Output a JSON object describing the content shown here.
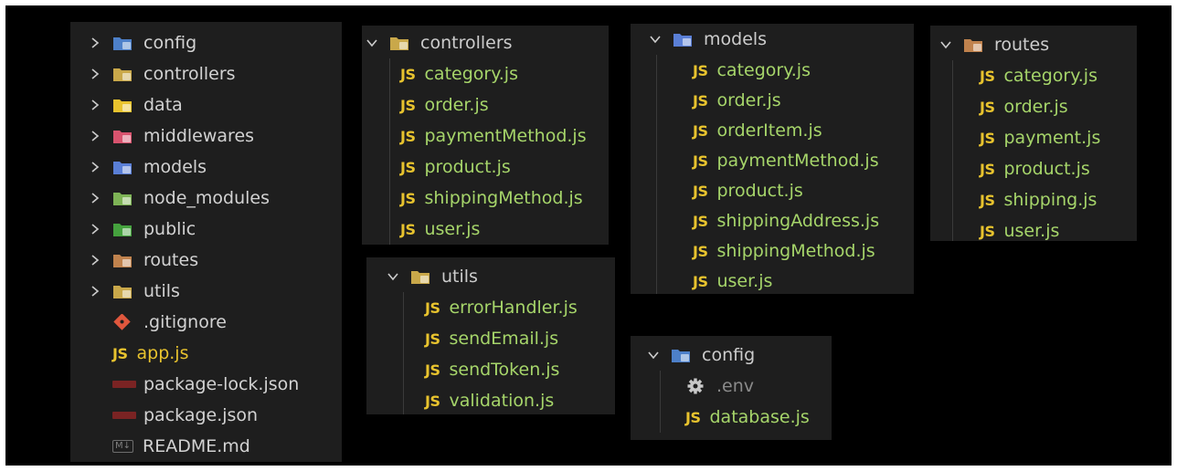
{
  "root_panel": {
    "folders": [
      {
        "name": "config",
        "icon": "config-folder-icon",
        "color": "#4d80c9"
      },
      {
        "name": "controllers",
        "icon": "controllers-folder-icon",
        "color": "#c9a84a"
      },
      {
        "name": "data",
        "icon": "data-folder-icon",
        "color": "#e8c32e"
      },
      {
        "name": "middlewares",
        "icon": "middlewares-folder-icon",
        "color": "#d8546f"
      },
      {
        "name": "models",
        "icon": "models-folder-icon",
        "color": "#5a7fd6"
      },
      {
        "name": "node_modules",
        "icon": "node-modules-folder-icon",
        "color": "#7eb356"
      },
      {
        "name": "public",
        "icon": "public-folder-icon",
        "color": "#45a23e"
      },
      {
        "name": "routes",
        "icon": "routes-folder-icon",
        "color": "#c0834e"
      },
      {
        "name": "utils",
        "icon": "utils-folder-icon",
        "color": "#c9a84a"
      }
    ],
    "files": [
      {
        "name": ".gitignore",
        "icon": "git-icon"
      },
      {
        "name": "app.js",
        "icon": "js-icon",
        "badge": "JS"
      },
      {
        "name": "package-lock.json",
        "icon": "npm-icon"
      },
      {
        "name": "package.json",
        "icon": "npm-icon"
      },
      {
        "name": "README.md",
        "icon": "markdown-icon",
        "badge": "M↓"
      }
    ]
  },
  "controllers_panel": {
    "folder": "controllers",
    "files": [
      "category.js",
      "order.js",
      "paymentMethod.js",
      "product.js",
      "shippingMethod.js",
      "user.js"
    ]
  },
  "utils_panel": {
    "folder": "utils",
    "files": [
      "errorHandler.js",
      "sendEmail.js",
      "sendToken.js",
      "validation.js"
    ]
  },
  "models_panel": {
    "folder": "models",
    "files": [
      "category.js",
      "order.js",
      "orderItem.js",
      "paymentMethod.js",
      "product.js",
      "shippingAddress.js",
      "shippingMethod.js",
      "user.js"
    ]
  },
  "config_panel": {
    "folder": "config",
    "files": [
      {
        "name": ".env",
        "icon": "gear-icon"
      },
      {
        "name": "database.js",
        "icon": "js-icon",
        "badge": "JS"
      }
    ]
  },
  "routes_panel": {
    "folder": "routes",
    "files": [
      "category.js",
      "order.js",
      "payment.js",
      "product.js",
      "shipping.js",
      "user.js"
    ]
  },
  "js_badge": "JS",
  "colors": {
    "panel_bg": "#1e1e1e",
    "outer_bg": "#000000",
    "js_text": "#a6d56a",
    "js_badge": "#e8c32e",
    "folder_text": "#cccccc"
  }
}
